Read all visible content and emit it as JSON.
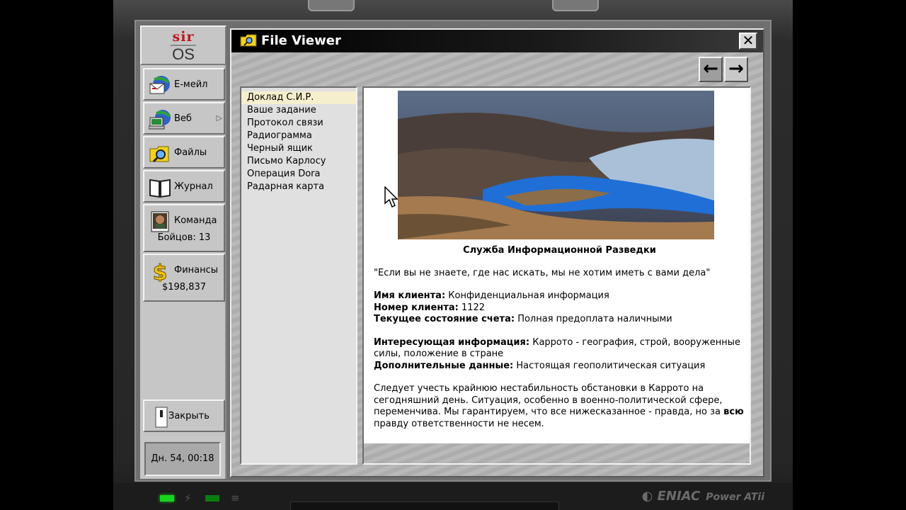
{
  "logo": {
    "top": "sir",
    "bottom": "OS"
  },
  "sidebar": {
    "items": [
      {
        "label": "Е-мейл",
        "icon": "email-icon"
      },
      {
        "label": "Веб",
        "icon": "web-icon"
      },
      {
        "label": "Файлы",
        "icon": "files-icon"
      },
      {
        "label": "Журнал",
        "icon": "journal-icon"
      },
      {
        "label": "Команда",
        "icon": "team-icon",
        "sub": "Бойцов: 13"
      },
      {
        "label": "Финансы",
        "icon": "dollar-icon",
        "sub": "$198,837"
      }
    ],
    "close_label": "Закрыть",
    "clock": "Дн. 54, 00:18"
  },
  "window": {
    "title": "File Viewer",
    "close_glyph": "✕",
    "back_glyph": "←",
    "forward_glyph": "→"
  },
  "files": [
    "Доклад С.И.Р.",
    "Ваше задание",
    "Протокол связи",
    "Радиограмма",
    "Черный ящик",
    "Письмо Карлосу",
    "Операция Dora",
    "Радарная карта"
  ],
  "document": {
    "heading": "Служба Информационной Разведки",
    "quote": "\"Если вы не знаете, где нас искать, мы не хотим иметь с вами дела\"",
    "client_name_label": "Имя клиента:",
    "client_name_value": "Конфиденциальная информация",
    "client_number_label": "Номер клиента:",
    "client_number_value": "1122",
    "account_label": "Текущее состояние счета:",
    "account_value": "Полная предоплата наличными",
    "interest_label": "Интересующая информация:",
    "interest_value": "Каррото - география, строй, вооруженные силы, положение в стране",
    "extra_label": "Дополнительные данные:",
    "extra_value": "Настоящая геополитическая ситуация",
    "para_start": "Следует учесть крайнюю нестабильность обстановки в Каррото на сегодняшний день. Ситуация, особенно в военно-политической сфере, переменчива. Мы гарантируем, что все нижесказанное - правда, но за",
    "para_bold": "всю",
    "para_end": "правду ответственности не несем."
  },
  "hardware": {
    "brand": "ENIAC",
    "model": "Power ATii"
  }
}
